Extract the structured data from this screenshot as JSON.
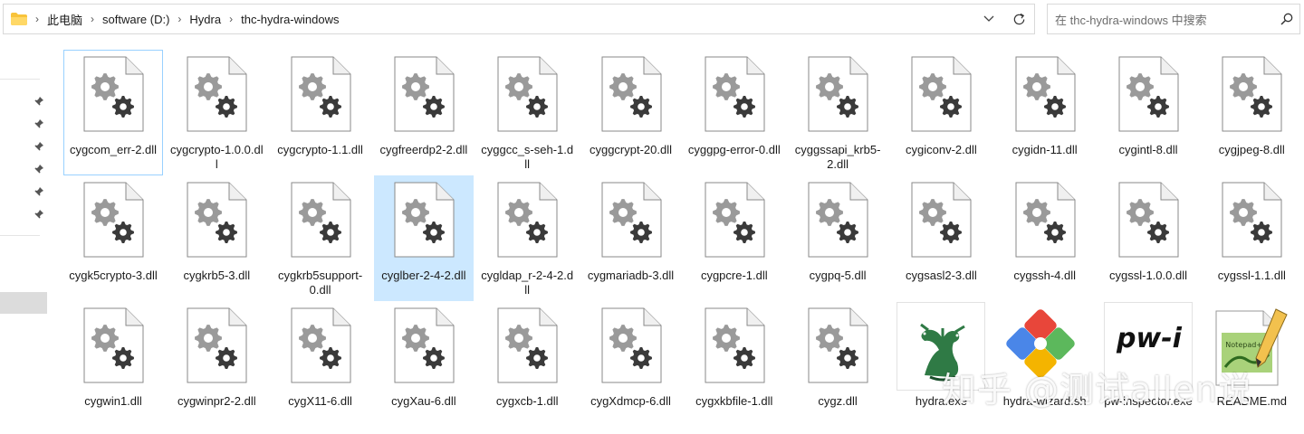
{
  "address_bar": {
    "breadcrumbs": [
      "此电脑",
      "software (D:)",
      "Hydra",
      "thc-hydra-windows"
    ]
  },
  "search": {
    "placeholder": "在 thc-hydra-windows 中搜索"
  },
  "colors": {
    "selection": "#cce8ff",
    "focus_border": "#99d1ff",
    "gear": "#9a9a9a",
    "gear_dark": "#3a3a3a",
    "folder": "#f8c33a"
  },
  "files": [
    {
      "name": "cygcom_err-2.dll",
      "type": "dll",
      "state": "focus"
    },
    {
      "name": "cygcrypto-1.0.0.dll",
      "type": "dll"
    },
    {
      "name": "cygcrypto-1.1.dll",
      "type": "dll"
    },
    {
      "name": "cygfreerdp2-2.dll",
      "type": "dll"
    },
    {
      "name": "cyggcc_s-seh-1.dll",
      "type": "dll"
    },
    {
      "name": "cyggcrypt-20.dll",
      "type": "dll"
    },
    {
      "name": "cyggpg-error-0.dll",
      "type": "dll"
    },
    {
      "name": "cyggssapi_krb5-2.dll",
      "type": "dll"
    },
    {
      "name": "cygiconv-2.dll",
      "type": "dll"
    },
    {
      "name": "cygidn-11.dll",
      "type": "dll"
    },
    {
      "name": "cygintl-8.dll",
      "type": "dll"
    },
    {
      "name": "cygjpeg-8.dll",
      "type": "dll"
    },
    {
      "name": "cygk5crypto-3.dll",
      "type": "dll"
    },
    {
      "name": "cygkrb5-3.dll",
      "type": "dll"
    },
    {
      "name": "cygkrb5support-0.dll",
      "type": "dll"
    },
    {
      "name": "cyglber-2-4-2.dll",
      "type": "dll",
      "state": "selected"
    },
    {
      "name": "cygldap_r-2-4-2.dll",
      "type": "dll"
    },
    {
      "name": "cygmariadb-3.dll",
      "type": "dll"
    },
    {
      "name": "cygpcre-1.dll",
      "type": "dll"
    },
    {
      "name": "cygpq-5.dll",
      "type": "dll"
    },
    {
      "name": "cygsasl2-3.dll",
      "type": "dll"
    },
    {
      "name": "cygssh-4.dll",
      "type": "dll"
    },
    {
      "name": "cygssl-1.0.0.dll",
      "type": "dll"
    },
    {
      "name": "cygssl-1.1.dll",
      "type": "dll"
    },
    {
      "name": "cygwin1.dll",
      "type": "dll"
    },
    {
      "name": "cygwinpr2-2.dll",
      "type": "dll"
    },
    {
      "name": "cygX11-6.dll",
      "type": "dll"
    },
    {
      "name": "cygXau-6.dll",
      "type": "dll"
    },
    {
      "name": "cygxcb-1.dll",
      "type": "dll"
    },
    {
      "name": "cygXdmcp-6.dll",
      "type": "dll"
    },
    {
      "name": "cygxkbfile-1.dll",
      "type": "dll"
    },
    {
      "name": "cygz.dll",
      "type": "dll"
    },
    {
      "name": "hydra.exe",
      "type": "exe-hydra"
    },
    {
      "name": "hydra-wizard.sh",
      "type": "sh"
    },
    {
      "name": "pw-inspector.exe",
      "type": "exe-pw",
      "thumb_text": "pw-i"
    },
    {
      "name": "README.md",
      "type": "md",
      "thumb_text": "Notepad++"
    }
  ],
  "watermark": "知乎 @测试allen说"
}
